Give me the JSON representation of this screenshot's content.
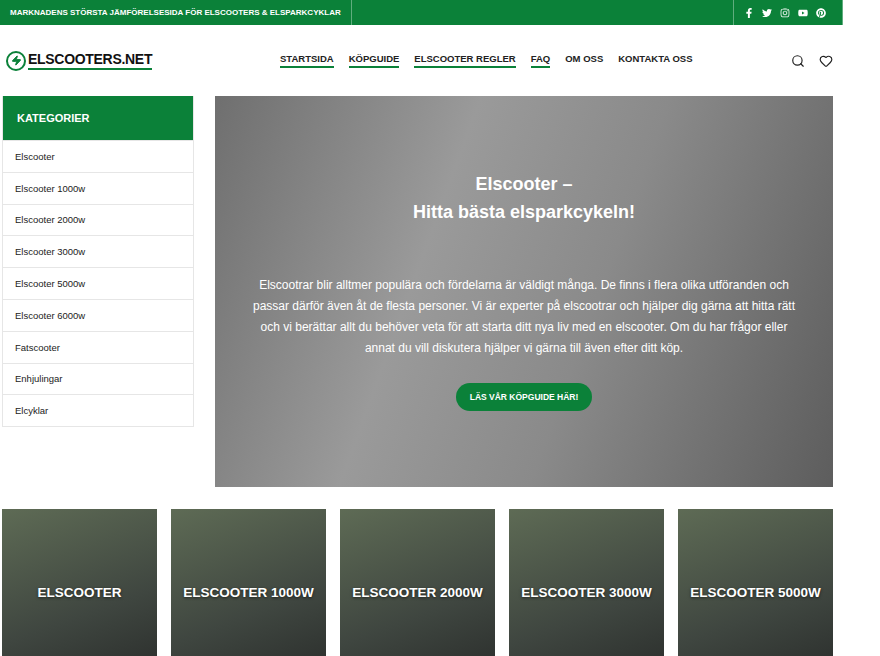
{
  "topbar": {
    "tagline": "MARKNADENS STÖRSTA JÄMFÖRELSESIDA FÖR ELSCOOTERS & ELSPARKCYKLAR"
  },
  "logo": {
    "text": "ELSCOOTERS.NET"
  },
  "nav": [
    {
      "label": "STARTSIDA",
      "highlighted": true
    },
    {
      "label": "KÖPGUIDE",
      "highlighted": true
    },
    {
      "label": "ELSCOOTER REGLER",
      "highlighted": true
    },
    {
      "label": "FAQ",
      "highlighted": true
    },
    {
      "label": "OM OSS",
      "highlighted": false
    },
    {
      "label": "KONTAKTA OSS",
      "highlighted": false
    }
  ],
  "sidebar": {
    "title": "KATEGORIER",
    "items": [
      "Elscooter",
      "Elscooter 1000w",
      "Elscooter 2000w",
      "Elscooter 3000w",
      "Elscooter 5000w",
      "Elscooter 6000w",
      "Fatscooter",
      "Enhjulingar",
      "Elcyklar"
    ]
  },
  "hero": {
    "title": [
      "Elscooter –",
      "Hitta bästa elsparkcykeln!"
    ],
    "body": "Elscootrar blir alltmer populära och fördelarna är väldigt många. De finns i flera olika utföranden och passar därför även åt de flesta personer. Vi är experter på elscootrar och hjälper dig gärna att hitta rätt och vi berättar allt du behöver veta för att starta ditt nya liv med en elscooter. Om du har frågor eller annat du vill diskutera hjälper vi gärna till även efter ditt köp.",
    "button": "LÄS VÅR KÖPGUIDE HÄR!"
  },
  "cards": [
    "ELSCOOTER",
    "ELSCOOTER 1000W",
    "ELSCOOTER 2000W",
    "ELSCOOTER 3000W",
    "ELSCOOTER 5000W"
  ]
}
